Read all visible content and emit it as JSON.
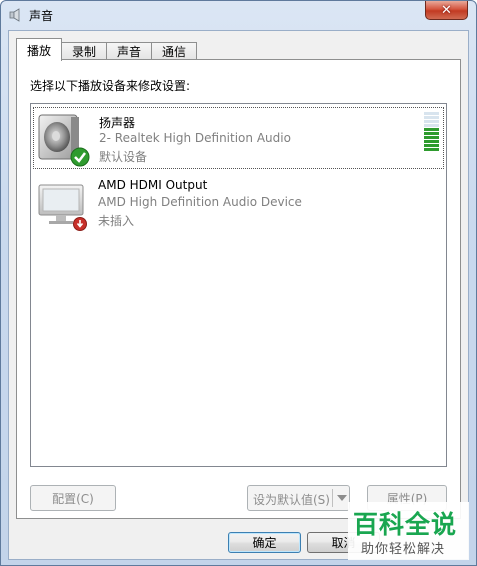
{
  "window": {
    "title": "声音",
    "close_label": "✕"
  },
  "tabs": [
    {
      "label": "播放",
      "active": true
    },
    {
      "label": "录制",
      "active": false
    },
    {
      "label": "声音",
      "active": false
    },
    {
      "label": "通信",
      "active": false
    }
  ],
  "playback": {
    "instruction": "选择以下播放设备来修改设置:",
    "devices": [
      {
        "name": "扬声器",
        "description": "2- Realtek High Definition Audio",
        "status": "默认设备",
        "icon": "speaker-icon",
        "badge": "default-check-icon",
        "selected": true,
        "level_percent": 55
      },
      {
        "name": "AMD HDMI Output",
        "description": "AMD High Definition Audio Device",
        "status": "未插入",
        "icon": "monitor-icon",
        "badge": "unplugged-icon",
        "selected": false
      }
    ]
  },
  "buttons": {
    "configure": "配置(C)",
    "set_default": "设为默认值(S)",
    "properties": "属性(P)",
    "ok": "确定",
    "cancel": "取消"
  },
  "watermark": {
    "main": "百科全说",
    "sub": "助你轻松解决"
  },
  "colors": {
    "check_green": "#2e9b2e",
    "unplugged_red": "#c8302a",
    "watermark_green": "#19a650"
  }
}
